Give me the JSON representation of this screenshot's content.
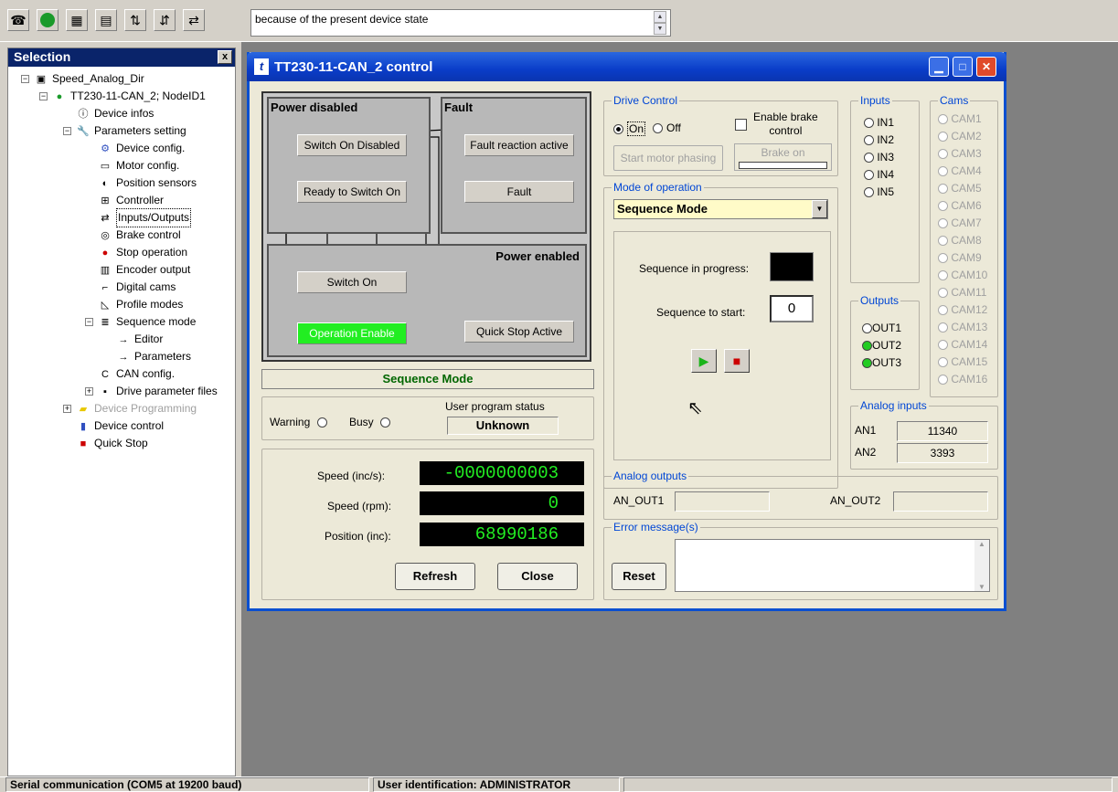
{
  "toolbar": {
    "icons": [
      "device-icon",
      "status-led-icon",
      "oscilloscope-icon",
      "document-icon",
      "upload-icon",
      "download-icon",
      "transfer-icon"
    ],
    "message": "because of the present device state"
  },
  "selection": {
    "title": "Selection",
    "close": "x",
    "tree": [
      {
        "label": "Speed_Analog_Dir",
        "level": 0
      },
      {
        "label": "TT230-11-CAN_2; NodeID1",
        "level": 1
      },
      {
        "label": "Device infos",
        "level": 2
      },
      {
        "label": "Parameters setting",
        "level": 2
      },
      {
        "label": "Device config.",
        "level": 3
      },
      {
        "label": "Motor config.",
        "level": 3
      },
      {
        "label": "Position sensors",
        "level": 3
      },
      {
        "label": "Controller",
        "level": 3
      },
      {
        "label": "Inputs/Outputs",
        "level": 3
      },
      {
        "label": "Brake control",
        "level": 3
      },
      {
        "label": "Stop operation",
        "level": 3
      },
      {
        "label": "Encoder output",
        "level": 3
      },
      {
        "label": "Digital cams",
        "level": 3
      },
      {
        "label": "Profile modes",
        "level": 3
      },
      {
        "label": "Sequence mode",
        "level": 3
      },
      {
        "label": "Editor",
        "level": 4
      },
      {
        "label": "Parameters",
        "level": 4
      },
      {
        "label": "CAN config.",
        "level": 3
      },
      {
        "label": "Drive parameter files",
        "level": 3
      },
      {
        "label": "Device Programming",
        "level": 2
      },
      {
        "label": "Device control",
        "level": 2
      },
      {
        "label": "Quick Stop",
        "level": 2
      }
    ]
  },
  "dialog": {
    "title": "TT230-11-CAN_2 control",
    "state_machine": {
      "power_disabled": "Power disabled",
      "fault": "Fault",
      "power_enabled": "Power enabled",
      "switch_on_disabled": "Switch On Disabled",
      "ready_to_switch_on": "Ready to Switch On",
      "switch_on": "Switch On",
      "operation_enable": "Operation Enable",
      "fault_reaction_active": "Fault reaction active",
      "fault_state": "Fault",
      "quick_stop_active": "Quick Stop Active",
      "active_color": "#22ee22"
    },
    "mode_label": "Sequence Mode",
    "warning": "Warning",
    "busy": "Busy",
    "user_program_status_label": "User program status",
    "user_program_status": "Unknown",
    "speed_inc_label": "Speed (inc/s):",
    "speed_inc": "-0000000003",
    "speed_rpm_label": "Speed (rpm):",
    "speed_rpm": "0",
    "position_label": "Position (inc):",
    "position": "68990186",
    "refresh": "Refresh",
    "close": "Close",
    "drive_control": {
      "label": "Drive Control",
      "on": "On",
      "off": "Off",
      "enable_brake": "Enable brake",
      "enable_brake2": "control",
      "start_motor_phasing": "Start motor phasing",
      "brake_on": "Brake on"
    },
    "mode_of_operation": {
      "label": "Mode of operation",
      "value": "Sequence Mode",
      "seq_in_progress": "Sequence in progress:",
      "seq_to_start": "Sequence to start:",
      "seq_to_start_value": "0"
    },
    "inputs": {
      "label": "Inputs",
      "items": [
        "IN1",
        "IN2",
        "IN3",
        "IN4",
        "IN5"
      ]
    },
    "outputs": {
      "label": "Outputs",
      "items": [
        {
          "name": "OUT1",
          "on": false
        },
        {
          "name": "OUT2",
          "on": true
        },
        {
          "name": "OUT3",
          "on": true
        }
      ]
    },
    "cams": {
      "label": "Cams",
      "items": [
        "CAM1",
        "CAM2",
        "CAM3",
        "CAM4",
        "CAM5",
        "CAM6",
        "CAM7",
        "CAM8",
        "CAM9",
        "CAM10",
        "CAM11",
        "CAM12",
        "CAM13",
        "CAM14",
        "CAM15",
        "CAM16"
      ]
    },
    "analog_inputs": {
      "label": "Analog inputs",
      "an1_label": "AN1",
      "an1": "11340",
      "an2_label": "AN2",
      "an2": "3393"
    },
    "analog_outputs": {
      "label": "Analog outputs",
      "out1": "AN_OUT1",
      "out2": "AN_OUT2"
    },
    "errors": {
      "label": "Error message(s)",
      "reset": "Reset"
    }
  },
  "statusbar": {
    "comm": "Serial communication (COM5 at 19200 baud)",
    "user": "User identification: ADMINISTRATOR"
  }
}
